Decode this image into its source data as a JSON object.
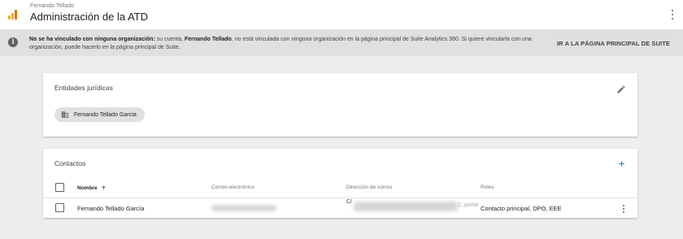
{
  "header": {
    "account_name": "Fernando Tellado",
    "app_title": "Administración de la ATD",
    "logo_icon": "analytics-logo-icon",
    "more_icon": "more-vert-icon",
    "colors": {
      "logo_orange": "#f9ab00",
      "logo_dark_orange": "#e37400"
    }
  },
  "banner": {
    "icon": "info-icon",
    "bold_text": "No se ha vinculado con ninguna organización:",
    "text_part1": " su cuenta, ",
    "bold_name": "Fernando Tellado",
    "text_part2": ", no está vinculada con ninguna organización en la página principal de Suite Analytics 360. Si quiere vincularla con una organización, puede hacerlo en la página principal de Suite.",
    "link_label": "IR A LA PÁGINA PRINCIPAL DE SUITE"
  },
  "legal_entities": {
    "title": "Entidades jurídicas",
    "edit_icon": "pencil-icon",
    "chip_icon": "building-icon",
    "chip_label": "Fernando Tellado García"
  },
  "contacts": {
    "title": "Contactos",
    "add_icon": "plus-icon",
    "columns": {
      "name": "Nombre",
      "email": "Correo electrónico",
      "address": "Dirección de correo",
      "roles": "Roles"
    },
    "sort_icon": "arrow-up-icon",
    "rows": [
      {
        "name": "Fernando Tellado García",
        "address_prefix": "C/",
        "address_suffix": "2, portal",
        "roles": "Contacto principal, DPO, EEE"
      }
    ],
    "accent_color": "#1a73e8"
  }
}
